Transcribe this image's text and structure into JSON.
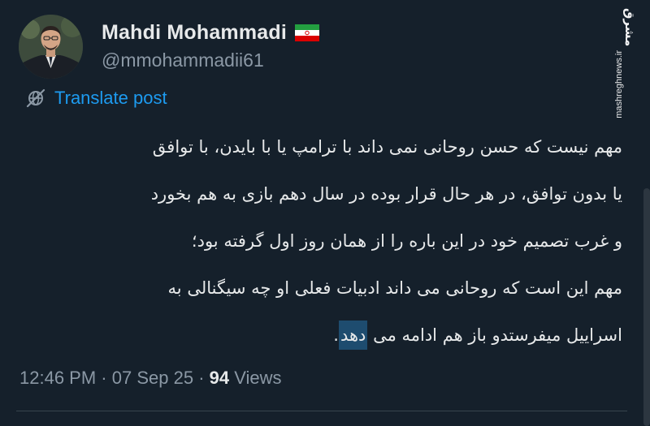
{
  "author": {
    "display_name": "Mahdi Mohammadi",
    "handle": "@mmohammadii61",
    "flag_icon": "iran-flag-icon"
  },
  "translate": {
    "label": "Translate post",
    "icon": "globe-slash-icon"
  },
  "watermark": {
    "logo": "مشرق",
    "site": "mashreghnews.ir"
  },
  "tweet": {
    "lines": [
      "مهم نیست که حسن روحانی نمی داند با ترامپ یا با بایدن، با توافق",
      "یا بدون توافق، در هر حال قرار بوده در سال دهم بازی به هم بخورد",
      "و غرب تصمیم خود در این باره را از همان روز اول گرفته بود؛",
      "مهم این است که روحانی می داند ادبیات فعلی او چه سیگنالی به"
    ],
    "last_line_prefix": "اسراییل میفرستدو باز هم ادامه می ",
    "last_line_highlight": "دهد",
    "last_line_suffix": "."
  },
  "meta": {
    "time": "12:46 PM",
    "separator": "·",
    "date": "07 Sep 25",
    "views_count": "94",
    "views_label": "Views"
  },
  "colors": {
    "background": "#15202b",
    "accent": "#1d9bf0",
    "secondary_text": "#8b98a5",
    "highlight": "#1e4c6f"
  }
}
